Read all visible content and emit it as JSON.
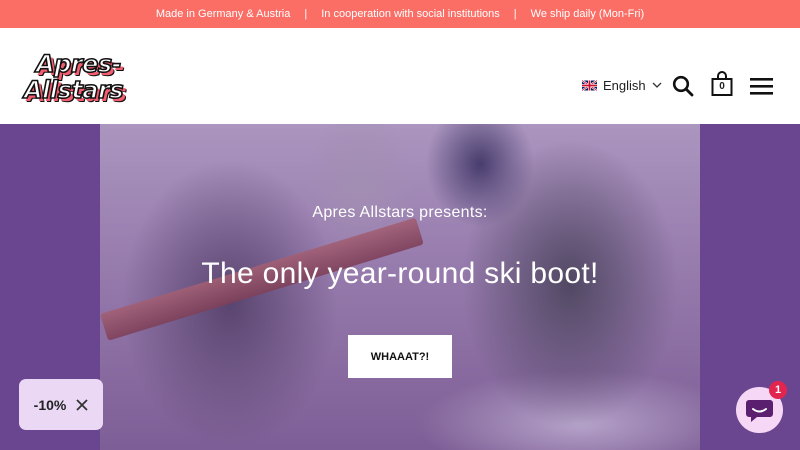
{
  "announcement": {
    "items": [
      "Made in Germany & Austria",
      "In cooperation with social institutions",
      "We ship daily (Mon-Fri)"
    ],
    "separator": "|",
    "color": "#fb6e66"
  },
  "header": {
    "logo": {
      "line1": "Apres-",
      "line2": "Allstars"
    },
    "language": {
      "label": "English",
      "flag_icon": "uk-flag-icon"
    },
    "icons": {
      "search": "search-icon",
      "cart": "cart-icon",
      "menu": "hamburger-menu-icon"
    },
    "cart_count": "0"
  },
  "hero": {
    "subtitle": "Apres Allstars presents:",
    "title": "The only year-round ski boot!",
    "cta_label": "WHAAAT?!",
    "background_color": "#6a4690"
  },
  "discount_popup": {
    "label": "-10%",
    "close_icon": "close-icon"
  },
  "chat": {
    "badge_count": "1",
    "icon": "chat-bubble-icon"
  }
}
